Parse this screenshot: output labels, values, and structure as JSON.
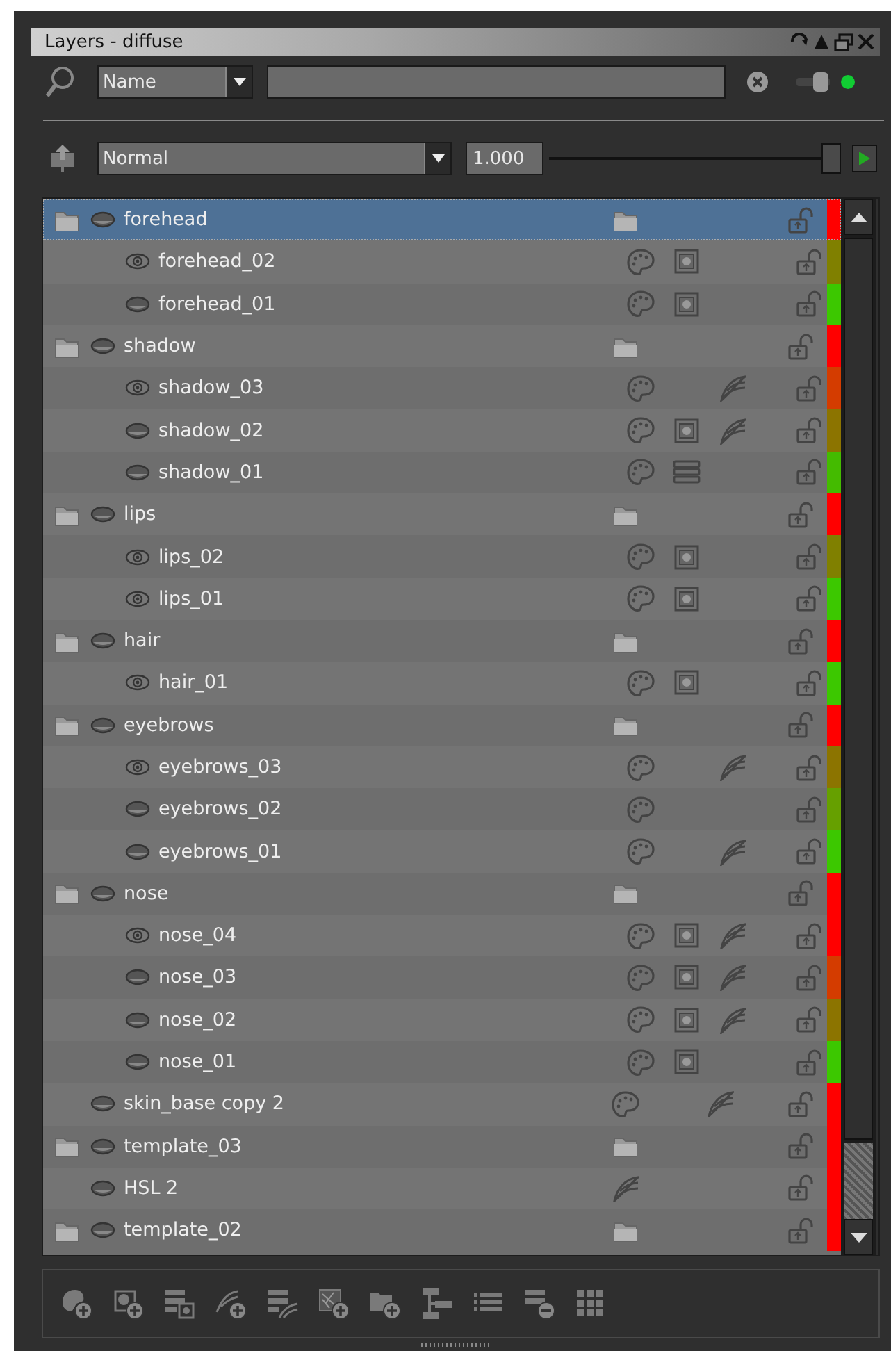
{
  "window": {
    "title": "Layers - diffuse"
  },
  "search": {
    "field_type": "Name",
    "toggle_on": true
  },
  "blend": {
    "mode": "Normal",
    "opacity": "1.000",
    "level": 1
  },
  "layers": [
    {
      "name": "forehead",
      "kind": "folder",
      "selected": true,
      "eye_open": false,
      "color": "#ff0000",
      "children": [
        {
          "name": "forehead_02",
          "kind": "paint",
          "selected": false,
          "eye_open": true,
          "mask": true,
          "stack": false,
          "effect": false,
          "color": "#808000"
        },
        {
          "name": "forehead_01",
          "kind": "paint",
          "selected": false,
          "eye_open": false,
          "mask": true,
          "stack": false,
          "effect": false,
          "color": "#3cc800"
        }
      ]
    },
    {
      "name": "shadow",
      "kind": "folder",
      "selected": false,
      "eye_open": false,
      "color": "#ff0000",
      "children": [
        {
          "name": "shadow_03",
          "kind": "paint",
          "selected": false,
          "eye_open": true,
          "mask": false,
          "stack": false,
          "effect": true,
          "color": "#d43c00"
        },
        {
          "name": "shadow_02",
          "kind": "paint",
          "selected": false,
          "eye_open": false,
          "mask": true,
          "stack": false,
          "effect": true,
          "color": "#8c7400"
        },
        {
          "name": "shadow_01",
          "kind": "paint",
          "selected": false,
          "eye_open": false,
          "mask": false,
          "stack": true,
          "effect": false,
          "color": "#44bb00"
        }
      ]
    },
    {
      "name": "lips",
      "kind": "folder",
      "selected": false,
      "eye_open": false,
      "color": "#ff0000",
      "children": [
        {
          "name": "lips_02",
          "kind": "paint",
          "selected": false,
          "eye_open": true,
          "mask": true,
          "stack": false,
          "effect": false,
          "color": "#808000"
        },
        {
          "name": "lips_01",
          "kind": "paint",
          "selected": false,
          "eye_open": true,
          "mask": true,
          "stack": false,
          "effect": false,
          "color": "#3cc800"
        }
      ]
    },
    {
      "name": "hair",
      "kind": "folder",
      "selected": false,
      "eye_open": false,
      "color": "#ff0000",
      "children": [
        {
          "name": "hair_01",
          "kind": "paint",
          "selected": false,
          "eye_open": true,
          "mask": true,
          "stack": false,
          "effect": false,
          "color": "#3cc800"
        }
      ]
    },
    {
      "name": "eyebrows",
      "kind": "folder",
      "selected": false,
      "eye_open": false,
      "color": "#ff0000",
      "children": [
        {
          "name": "eyebrows_03",
          "kind": "paint",
          "selected": false,
          "eye_open": true,
          "mask": false,
          "stack": false,
          "effect": true,
          "color": "#8c7400"
        },
        {
          "name": "eyebrows_02",
          "kind": "paint",
          "selected": false,
          "eye_open": false,
          "mask": false,
          "stack": false,
          "effect": false,
          "color": "#66a000"
        },
        {
          "name": "eyebrows_01",
          "kind": "paint",
          "selected": false,
          "eye_open": false,
          "mask": false,
          "stack": false,
          "effect": true,
          "color": "#3cc800"
        }
      ]
    },
    {
      "name": "nose",
      "kind": "folder",
      "selected": false,
      "eye_open": false,
      "color": "#ff0000",
      "children": [
        {
          "name": "nose_04",
          "kind": "paint",
          "selected": false,
          "eye_open": true,
          "mask": true,
          "stack": false,
          "effect": true,
          "color": "#ff0000"
        },
        {
          "name": "nose_03",
          "kind": "paint",
          "selected": false,
          "eye_open": false,
          "mask": true,
          "stack": false,
          "effect": true,
          "color": "#d43c00"
        },
        {
          "name": "nose_02",
          "kind": "paint",
          "selected": false,
          "eye_open": false,
          "mask": true,
          "stack": false,
          "effect": true,
          "color": "#8c7400"
        },
        {
          "name": "nose_01",
          "kind": "paint",
          "selected": false,
          "eye_open": false,
          "mask": true,
          "stack": false,
          "effect": false,
          "color": "#3cc800"
        }
      ]
    },
    {
      "name": "skin_base copy 2",
      "kind": "paint",
      "selected": false,
      "eye_open": false,
      "mask": false,
      "stack": false,
      "effect": true,
      "color": "#ff0000"
    },
    {
      "name": "template_03",
      "kind": "folder",
      "selected": false,
      "eye_open": false,
      "color": "#ff0000"
    },
    {
      "name": "HSL 2",
      "kind": "adjustment",
      "selected": false,
      "eye_open": false,
      "color": "#ff0000"
    },
    {
      "name": "template_02",
      "kind": "folder",
      "selected": false,
      "eye_open": false,
      "color": "#ff0000"
    }
  ]
}
